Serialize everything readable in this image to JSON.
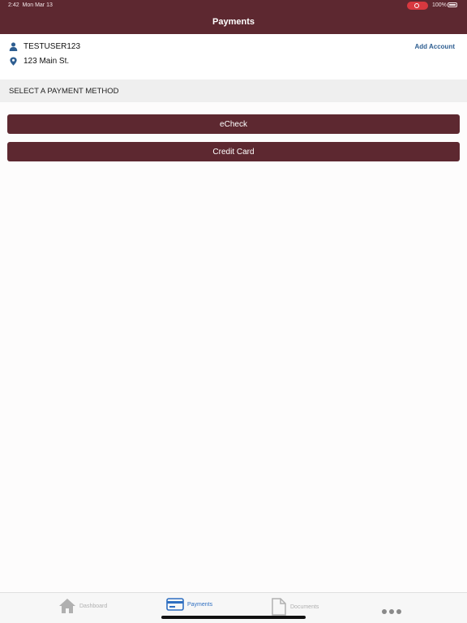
{
  "status_bar": {
    "time": "2:42",
    "date": "Mon Mar 13",
    "battery": "100%"
  },
  "nav": {
    "title": "Payments"
  },
  "account": {
    "username": "TESTUSER123",
    "address": "123 Main St.",
    "add_account_label": "Add Account",
    "user_icon": "person-icon",
    "address_icon": "location-pin-icon"
  },
  "section": {
    "title": "SELECT A PAYMENT METHOD"
  },
  "methods": [
    {
      "label": "eCheck"
    },
    {
      "label": "Credit Card"
    }
  ],
  "tabs": [
    {
      "label": "Dashboard",
      "icon": "house-icon",
      "active": false
    },
    {
      "label": "Payments",
      "icon": "credit-card-icon",
      "active": true
    },
    {
      "label": "Documents",
      "icon": "document-icon",
      "active": false
    },
    {
      "label": "",
      "icon": "more-icon",
      "active": false
    }
  ],
  "colors": {
    "brand": "#5d2830",
    "link": "#2e5e91",
    "active_tab": "#2f6fc1"
  }
}
